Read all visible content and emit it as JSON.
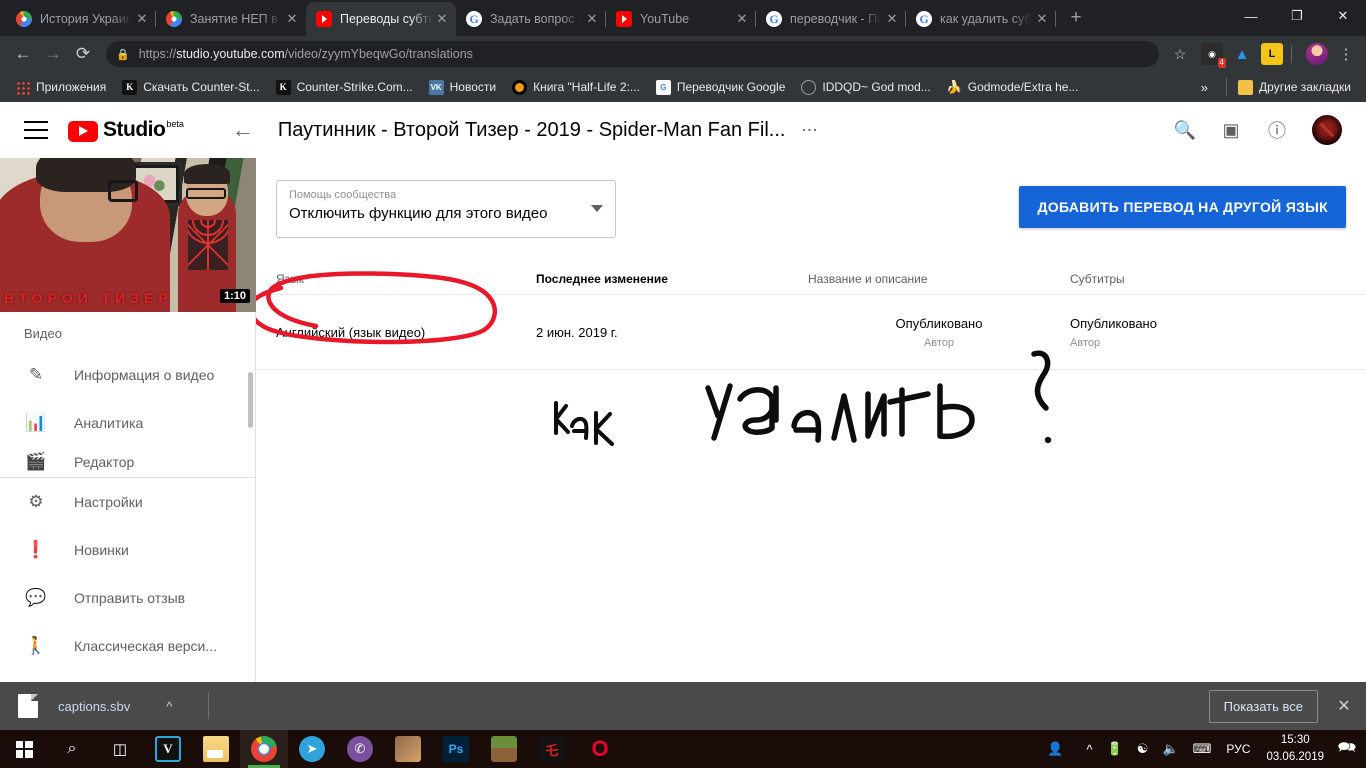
{
  "browser": {
    "tabs": [
      {
        "title": "История Украины",
        "favicon": "chrome-icon"
      },
      {
        "title": "Занятие НЕП в Ук",
        "favicon": "chrome-icon"
      },
      {
        "title": "Переводы субтитр",
        "favicon": "youtube-icon",
        "active": true
      },
      {
        "title": "Задать вопрос - С",
        "favicon": "google-icon"
      },
      {
        "title": "YouTube",
        "favicon": "youtube-icon"
      },
      {
        "title": "переводчик - Пои",
        "favicon": "google-icon"
      },
      {
        "title": "как удалить субти",
        "favicon": "google-icon"
      }
    ],
    "new_tab_label": "+",
    "window_controls": {
      "minimize": "—",
      "maximize": "❐",
      "close": "✕"
    },
    "toolbar": {
      "back": "←",
      "forward": "→",
      "reload": "⟳",
      "lock_icon": "lock-icon",
      "url_scheme": "https://",
      "url_host": "studio.youtube.com",
      "url_path": "/video/zyymYbeqwGo/translations",
      "star": "☆",
      "extension_badge": "4",
      "menu": "⋮"
    },
    "bookmarks": [
      {
        "label": "Приложения",
        "icon": "apps-grid-icon"
      },
      {
        "label": "Скачать Counter-St...",
        "icon": "counter-strike-icon"
      },
      {
        "label": "Counter-Strike.Com...",
        "icon": "counter-strike-icon"
      },
      {
        "label": "Новости",
        "icon": "vk-icon"
      },
      {
        "label": "Книга \"Half-Life 2:...",
        "icon": "halflife-icon"
      },
      {
        "label": "Переводчик Google",
        "icon": "google-translate-icon"
      },
      {
        "label": "IDDQD~ God mod...",
        "icon": "iddqd-icon"
      },
      {
        "label": "Godmode/Extra he...",
        "icon": "banana-icon"
      }
    ],
    "bookmarks_overflow": "»",
    "other_bookmarks": "Другие закладки"
  },
  "studio": {
    "logo_word": "Studio",
    "logo_beta": "beta",
    "back_arrow": "←",
    "video_title": "Паутинник - Второй Тизер - 2019 - Spider-Man Fan Fil...",
    "title_menu": "⋮",
    "header_icons": {
      "search": "search-icon",
      "create": "create-video-icon",
      "help": "help-icon",
      "avatar": "channel-avatar"
    }
  },
  "sidebar": {
    "thumbnail": {
      "caption": "ВТОРОЙ ТИЗЕР",
      "duration": "1:10"
    },
    "section_label": "Видео",
    "items": [
      {
        "label": "Информация о видео",
        "icon": "pencil-icon"
      },
      {
        "label": "Аналитика",
        "icon": "bar-chart-icon"
      },
      {
        "label": "Редактор",
        "icon": "clapperboard-icon"
      },
      {
        "label": "Настройки",
        "icon": "gear-icon"
      },
      {
        "label": "Новинки",
        "icon": "exclamation-badge-icon"
      },
      {
        "label": "Отправить отзыв",
        "icon": "feedback-icon"
      },
      {
        "label": "Классическая верси...",
        "icon": "exit-icon"
      }
    ]
  },
  "main": {
    "community_select": {
      "label": "Помощь сообщества",
      "value": "Отключить функцию для этого видео",
      "arrow": "chevron-down-icon"
    },
    "add_translation_button": "ДОБАВИТЬ ПЕРЕВОД НА ДРУГОЙ ЯЗЫК",
    "table": {
      "columns": [
        "Язык",
        "Последнее изменение",
        "Название и описание",
        "Субтитры"
      ],
      "rows": [
        {
          "language": "Английский (язык видео)",
          "modified": "2 июн. 2019 г.",
          "title_status": "Опубликовано",
          "title_author": "Автор",
          "subs_status": "Опубликовано",
          "subs_author": "Автор"
        }
      ]
    },
    "annotations": {
      "circle": "red-circle-around-language",
      "handwriting": "как удалить ?",
      "color_red": "#e8172a",
      "color_black": "#0d0d0d"
    }
  },
  "download_bar": {
    "file_icon": "file-icon",
    "file_name": "captions.sbv",
    "caret": "caret-up-icon",
    "show_all": "Показать все",
    "close": "✕"
  },
  "taskbar": {
    "start": "windows-logo-icon",
    "search": "search-icon",
    "task_view": "task-view-icon",
    "apps": [
      {
        "name": "vegas-icon",
        "glyph": "V"
      },
      {
        "name": "file-explorer-icon",
        "glyph": ""
      },
      {
        "name": "chrome-icon",
        "glyph": "",
        "active": true
      },
      {
        "name": "telegram-icon",
        "glyph": "➤"
      },
      {
        "name": "viber-icon",
        "glyph": "✆"
      },
      {
        "name": "photo-icon",
        "glyph": ""
      },
      {
        "name": "photoshop-icon",
        "glyph": "Ps"
      },
      {
        "name": "minecraft-icon",
        "glyph": ""
      },
      {
        "name": "garena-icon",
        "glyph": "乇"
      },
      {
        "name": "opera-icon",
        "glyph": "O"
      }
    ],
    "tray": {
      "people": "people-icon",
      "chevron": "chevron-up-icon",
      "battery": "battery-icon",
      "wifi": "wifi-icon",
      "volume": "volume-icon",
      "keyboard": "keyboard-icon",
      "language": "РУС",
      "time": "15:30",
      "date": "03.06.2019",
      "action_center": "action-center-icon"
    }
  }
}
